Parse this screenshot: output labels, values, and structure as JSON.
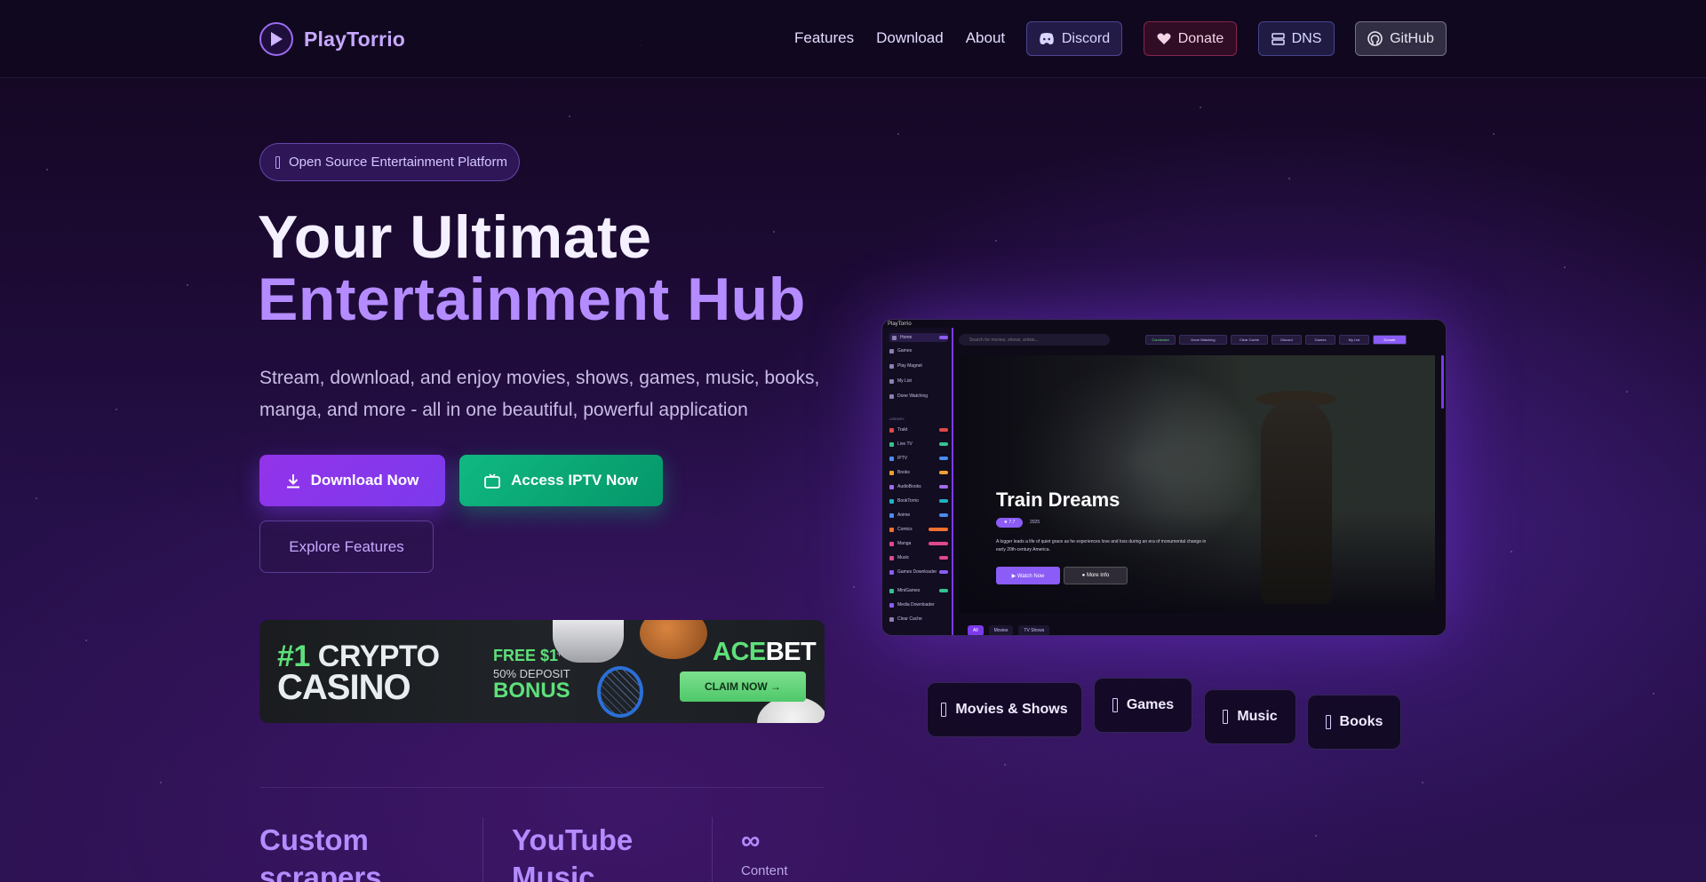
{
  "nav": {
    "brand": "PlayTorrio",
    "links": [
      "Features",
      "Download",
      "About"
    ],
    "discord": "Discord",
    "donate": "Donate",
    "dns": "DNS",
    "github": "GitHub"
  },
  "hero": {
    "badge": "Open Source Entertainment Platform",
    "title_line1": "Your Ultimate",
    "title_line2": "Entertainment Hub",
    "subtitle": "Stream, download, and enjoy movies, shows, games, music, books, manga, and more - all in one beautiful, powerful application",
    "download_btn": "Download Now",
    "iptv_btn": "Access IPTV Now",
    "explore_btn": "Explore Features"
  },
  "ad": {
    "line1_hash": "#1",
    "line1_rest": " CRYPTO",
    "line2": "CASINO",
    "free": "FREE $1",
    "plus": "+",
    "deposit": "50% DEPOSIT",
    "bonus": "BONUS",
    "brand_a": "ACE",
    "brand_b": "BET",
    "claim": "CLAIM NOW →"
  },
  "preview": {
    "window_title": "PlayTorrio",
    "sidebar": [
      "Home",
      "Games",
      "Play Magnet",
      "My List",
      "Done Watching"
    ],
    "library_label": "LIBRARY",
    "library": [
      "Trakt",
      "Live TV",
      "IPTV",
      "Books",
      "AudioBooks",
      "BookTorrio",
      "Anime",
      "Comics",
      "Manga",
      "Music",
      "Games Downloader",
      "MiniGames",
      "Media Downloader",
      "Clear Cache"
    ],
    "search_placeholder": "Search for movies, shows, artists...",
    "top_chips": [
      "Connected",
      "Done Watching",
      "Clear Cache",
      "Discord",
      "Games",
      "My List",
      "Donate"
    ],
    "movie_title": "Train Dreams",
    "rating": "★ 7.7",
    "year": "2025",
    "description": "A logger leads a life of quiet grace as he experiences love and loss during an era of monumental change in early 20th-century America.",
    "watch": "▶ Watch Now",
    "more": "● More Info",
    "tabs": [
      "All",
      "Movies",
      "TV Shows"
    ]
  },
  "categories": [
    "Movies & Shows",
    "Games",
    "Music",
    "Books"
  ],
  "stats": {
    "col1": "Custom scrapers",
    "col2": "YouTube Music",
    "col3_symbol": "∞",
    "col3_label": "Content"
  },
  "colors": {
    "accent": "#b48cff",
    "primary_button": "#7c3aed",
    "iptv_button": "#10b981"
  }
}
